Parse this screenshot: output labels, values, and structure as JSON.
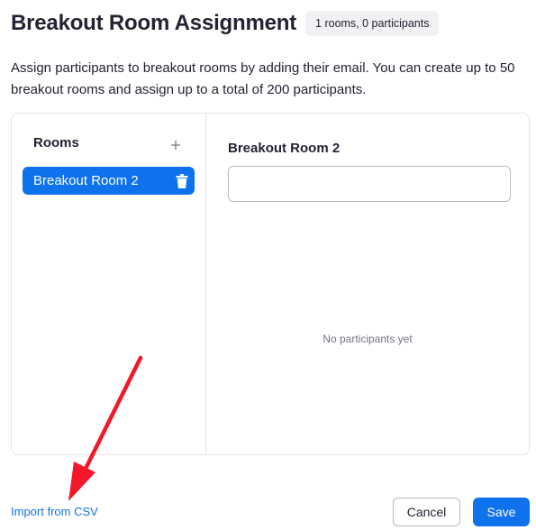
{
  "dialog": {
    "title": "Breakout Room Assignment",
    "count_badge": "1 rooms, 0 participants",
    "description": "Assign participants to breakout rooms by adding their email. You can create up to 50 breakout rooms and assign up to a total of 200 participants."
  },
  "rooms_panel": {
    "header": "Rooms",
    "add_icon": "plus-icon",
    "items": [
      {
        "label": "Breakout Room 2",
        "selected": true,
        "delete_icon": "trash-icon"
      }
    ]
  },
  "room_detail": {
    "title": "Breakout Room 2",
    "email_input": {
      "value": "",
      "placeholder": ""
    },
    "empty_state": "No participants yet"
  },
  "footer": {
    "import_link": "Import from CSV",
    "cancel_label": "Cancel",
    "save_label": "Save"
  },
  "annotation": {
    "type": "red-arrow",
    "points_to": "Import from CSV"
  },
  "colors": {
    "accent": "#0e72ed",
    "text": "#232333",
    "muted": "#747487",
    "border": "#e3e3ea",
    "annotation_red": "#f2182a"
  }
}
